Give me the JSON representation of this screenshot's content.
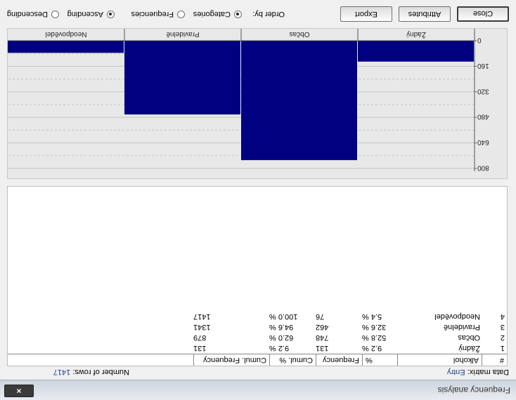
{
  "window": {
    "title": "Frequency analysis",
    "close_glyph": "×"
  },
  "info": {
    "data_matrix_label": "Data matrix:",
    "data_matrix_value": "Entry",
    "rows_label": "Number of rows:",
    "rows_value": "1417"
  },
  "table": {
    "columns": [
      "#",
      "Alkohol",
      "%",
      "Frequency",
      "Cumul. %",
      "Cumul. Frequency"
    ],
    "rows": [
      {
        "n": "1",
        "name": "Žádný",
        "pct": "9.2 %",
        "freq": "131",
        "cpct": "9.2 %",
        "cfreq": "131"
      },
      {
        "n": "2",
        "name": "Občas",
        "pct": "52.8 %",
        "freq": "748",
        "cpct": "62.0 %",
        "cfreq": "879"
      },
      {
        "n": "3",
        "name": "Pravidelně",
        "pct": "32.6 %",
        "freq": "462",
        "cpct": "94.6 %",
        "cfreq": "1341"
      },
      {
        "n": "4",
        "name": "Neodpovědel",
        "pct": "5.4 %",
        "freq": "76",
        "cpct": "100.0 %",
        "cfreq": "1417"
      }
    ]
  },
  "toolbar": {
    "close_label": "Close",
    "attributes_label": "Attributes",
    "export_label": "Export",
    "order_label": "Order by:",
    "categories_label": "Categories",
    "frequencies_label": "Frequencies",
    "ascending_label": "Ascending",
    "descending_label": "Descending",
    "order_selected": "Categories",
    "direction_selected": "Ascending"
  },
  "colors": {
    "bar": "#000080",
    "plot_bg": "#e8e8e8",
    "grid": "#c4c4c4"
  },
  "chart_data": {
    "type": "bar",
    "categories": [
      "Žádný",
      "Občas",
      "Pravidelně",
      "Neodpovědel"
    ],
    "values": [
      131,
      748,
      462,
      76
    ],
    "yticks": [
      "0",
      "160",
      "320",
      "480",
      "640",
      "800"
    ],
    "ylim": [
      0,
      800
    ],
    "grid": true
  }
}
